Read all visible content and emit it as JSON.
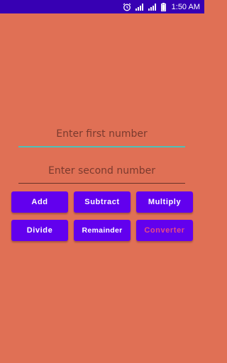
{
  "status_bar": {
    "time": "1:50 AM",
    "icons": [
      "alarm-icon",
      "signal-icon",
      "signal-icon",
      "battery-icon"
    ],
    "background": "#3700b3"
  },
  "form": {
    "first_placeholder": "Enter first number",
    "second_placeholder": "Enter second number",
    "first_value": "",
    "second_value": ""
  },
  "buttons": {
    "add": "Add",
    "subtract": "Subtract",
    "multiply": "Multiply",
    "divide": "Divide",
    "remainder": "Remainder",
    "converter": "Converter"
  },
  "colors": {
    "background": "#e07055",
    "button": "#6200ee",
    "accent_underline": "#4ec1b8",
    "converter_text": "#e44a86"
  }
}
